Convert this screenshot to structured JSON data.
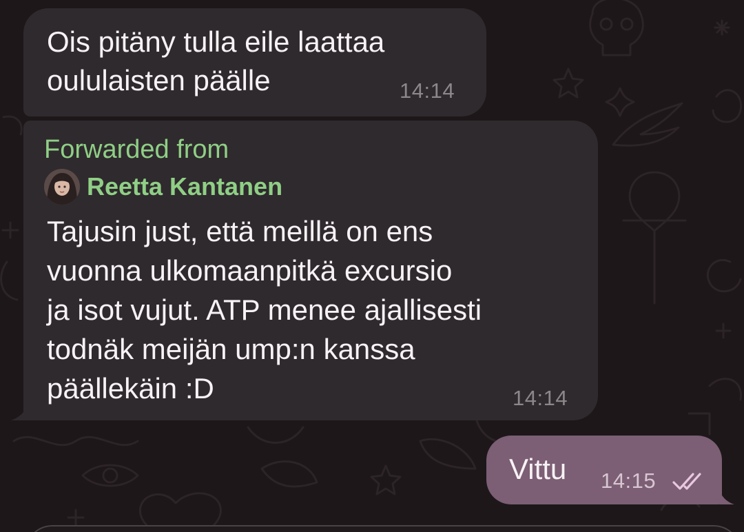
{
  "messages": [
    {
      "direction": "incoming",
      "lines": [
        "Ois pitäny tulla eile laattaa",
        "oululaisten päälle"
      ],
      "time": "14:14"
    },
    {
      "direction": "incoming",
      "forwarded_label": "Forwarded from",
      "forwarded_name": "Reetta Kantanen",
      "lines": [
        "Tajusin just, että meillä on ens",
        "vuonna ulkomaanpitkä excursio",
        "ja isot vujut. ATP menee ajallisesti",
        "todnäk meijän ump:n kanssa",
        "päällekäin :D"
      ],
      "time": "14:14"
    },
    {
      "direction": "outgoing",
      "lines": [
        "Vittu"
      ],
      "time": "14:15",
      "status_icon": "double-check-read-icon"
    }
  ],
  "colors": {
    "background": "#1d1719",
    "incoming_bubble": "#2f2a2d",
    "outgoing_bubble": "#7c5f74",
    "forward_accent": "#8fcf86",
    "time_text": "#8c878a",
    "read_checks": "#e9c7e1"
  }
}
